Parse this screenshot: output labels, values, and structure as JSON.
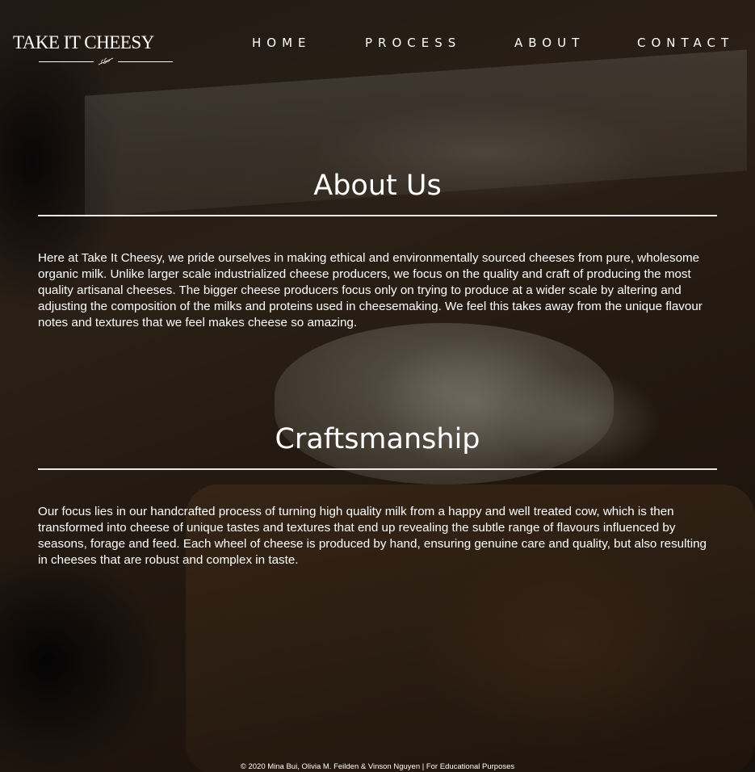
{
  "brand": {
    "name": "TAKE IT CHEESY"
  },
  "nav": {
    "items": [
      {
        "label": "HOME"
      },
      {
        "label": "PROCESS"
      },
      {
        "label": "ABOUT"
      },
      {
        "label": "CONTACT"
      }
    ]
  },
  "sections": [
    {
      "title": "About Us",
      "body": "Here at Take It Cheesy, we pride ourselves in making ethical and environmentally sourced cheeses from pure, wholesome organic milk. Unlike larger scale industrialized cheese producers, we focus on the quality and craft of producing the most quality artisanal cheeses. The bigger cheese producers focus only on trying to produce at a wider scale by altering and adjusting the composition of the milks and proteins used in cheesemaking. We feel this takes away from the unique flavour notes and textures that we feel makes cheese so amazing."
    },
    {
      "title": "Craftsmanship",
      "body": "Our focus lies in our handcrafted process of turning high quality milk from a happy and well treated cow, which is then transformed into cheese of unique tastes and textures that end up revealing the subtle range of flavours influenced by seasons, forage and feed. Each wheel of cheese is produced by hand, ensuring genuine care and quality, but also resulting in cheeses that are robust and complex in taste."
    }
  ],
  "footer": {
    "text": "© 2020 Mina Bui, Olivia M. Feilden & Vinson Nguyen  |  For Educational Purposes"
  }
}
